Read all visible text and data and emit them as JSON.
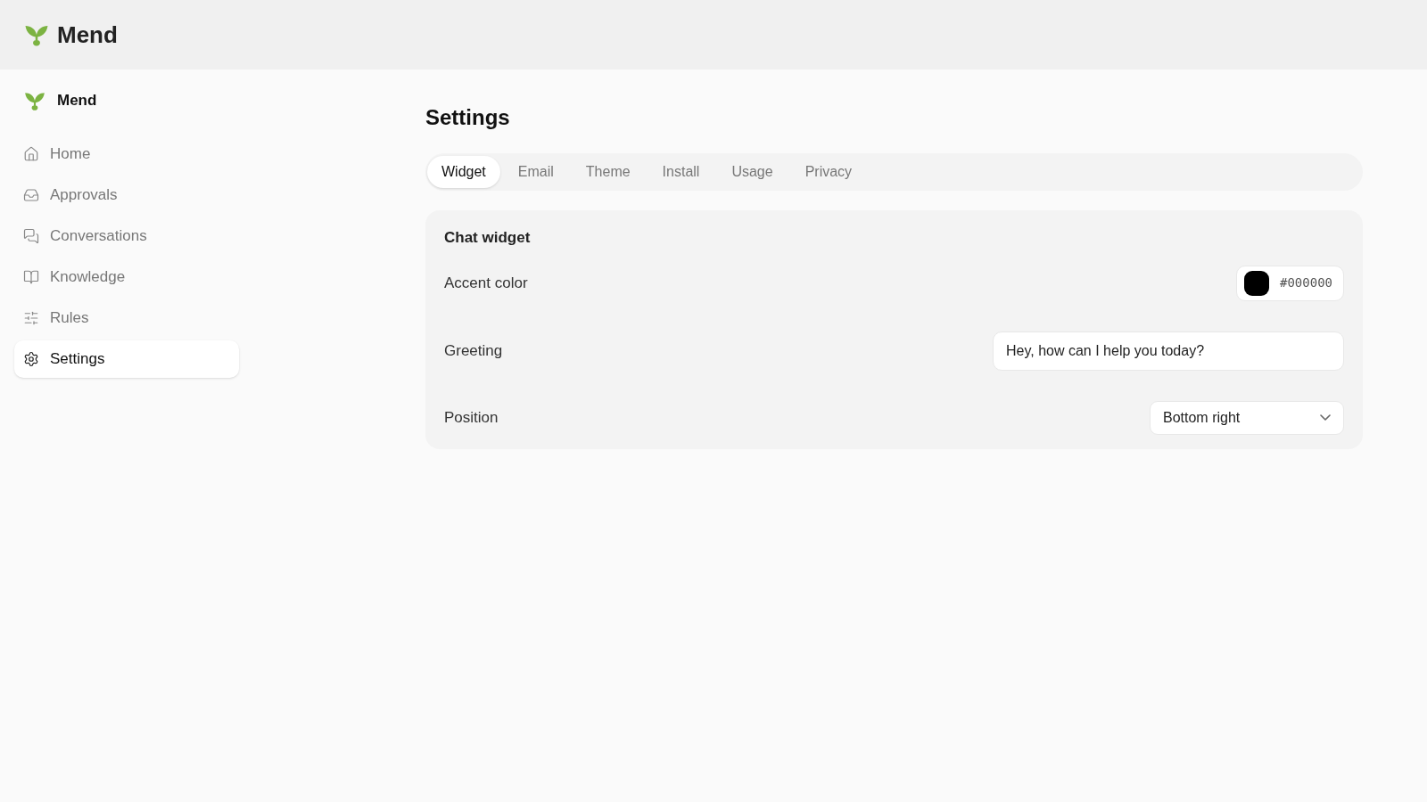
{
  "header": {
    "brand": "Mend"
  },
  "sidebar": {
    "brand": "Mend",
    "items": [
      {
        "label": "Home",
        "selected": false
      },
      {
        "label": "Approvals",
        "selected": false
      },
      {
        "label": "Conversations",
        "selected": false
      },
      {
        "label": "Knowledge",
        "selected": false
      },
      {
        "label": "Rules",
        "selected": false
      },
      {
        "label": "Settings",
        "selected": true
      }
    ]
  },
  "page_title": "Settings",
  "tabs": [
    {
      "label": "Widget",
      "selected": true
    },
    {
      "label": "Email",
      "selected": false
    },
    {
      "label": "Theme",
      "selected": false
    },
    {
      "label": "Install",
      "selected": false
    },
    {
      "label": "Usage",
      "selected": false
    },
    {
      "label": "Privacy",
      "selected": false
    }
  ],
  "card": {
    "title": "Chat widget",
    "fields": [
      {
        "kind": "color",
        "label": "Accent color",
        "value": "#000000",
        "color": "#000000"
      },
      {
        "kind": "text",
        "label": "Greeting",
        "value": "Hey, how can I help you today?"
      },
      {
        "kind": "select",
        "label": "Position",
        "value": "Bottom right"
      }
    ]
  }
}
